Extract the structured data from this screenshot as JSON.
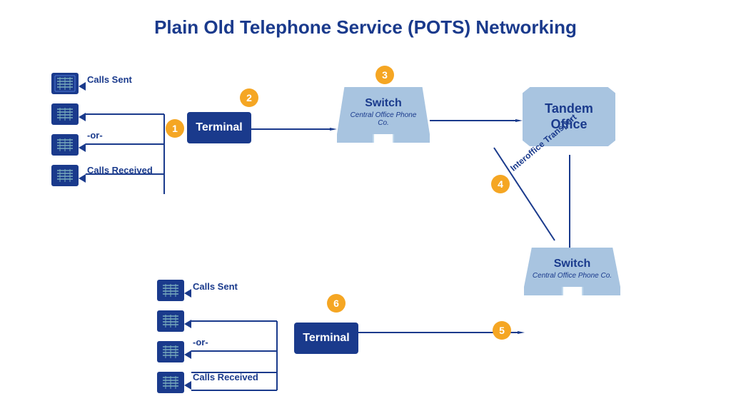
{
  "title": "Plain Old Telephone Service (POTS) Networking",
  "badges": {
    "b1": "1",
    "b2": "2",
    "b3": "3",
    "b4": "4",
    "b5": "5",
    "b6": "6"
  },
  "labels": {
    "calls_sent": "Calls Sent",
    "or": "-or-",
    "calls_received": "Calls Received",
    "terminal": "Terminal",
    "switch": "Switch",
    "switch_sub": "Central Office Phone Co.",
    "tandem_office": "Tandem Office",
    "interoffice_transport": "Interoffice Transport"
  },
  "colors": {
    "dark_blue": "#1a3a8c",
    "light_blue": "#a8c4e0",
    "orange": "#f5a623",
    "white": "#ffffff"
  }
}
